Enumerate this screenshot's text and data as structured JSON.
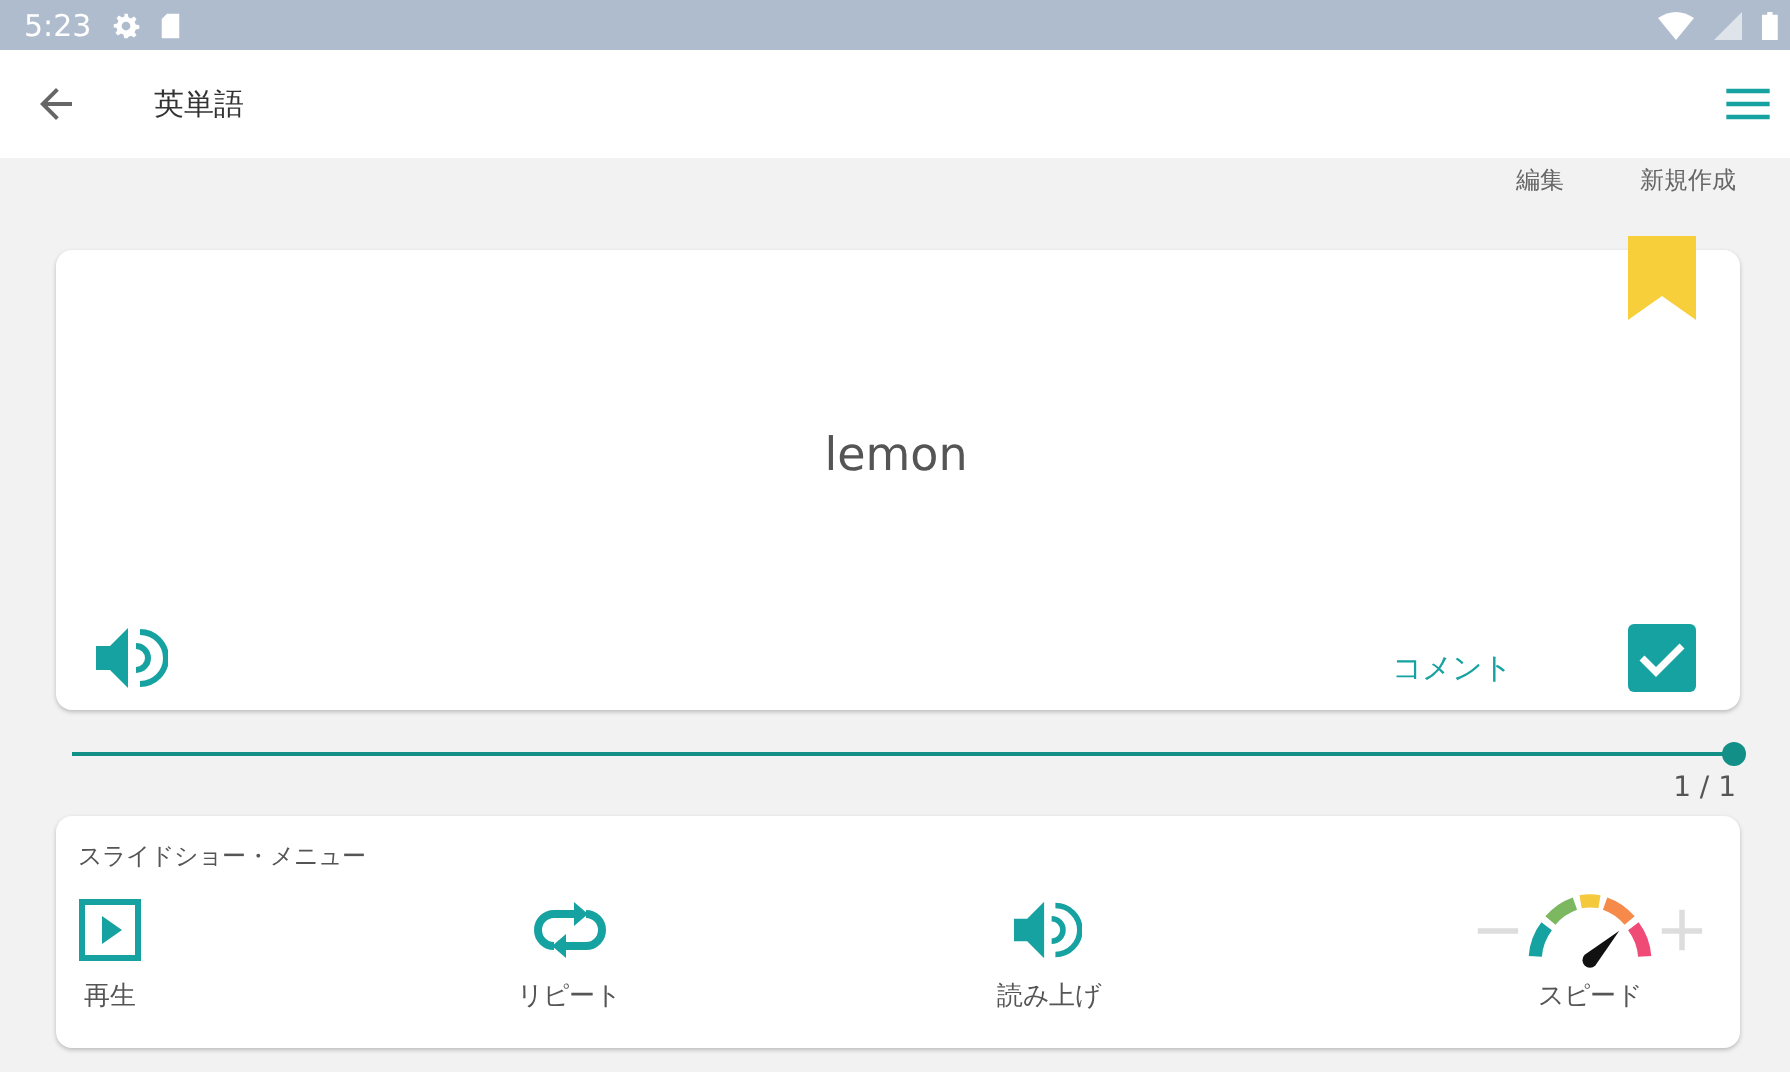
{
  "status_bar": {
    "time": "5:23"
  },
  "app_bar": {
    "title": "英単語"
  },
  "actions": [
    "編集",
    "新規作成"
  ],
  "card": {
    "word": "lemon",
    "bookmarked": true,
    "comment": "コメント",
    "checked": true
  },
  "progress": {
    "level": 1,
    "reading": "1 / 1"
  },
  "slideshow": {
    "title": "スライドショー・メニュー",
    "items": [
      {
        "kind": "play",
        "label": "再生"
      },
      {
        "kind": "repeat",
        "label": "リピート"
      },
      {
        "kind": "speak",
        "label": "読み上げ"
      },
      {
        "kind": "speed",
        "label": "スピード"
      }
    ]
  }
}
